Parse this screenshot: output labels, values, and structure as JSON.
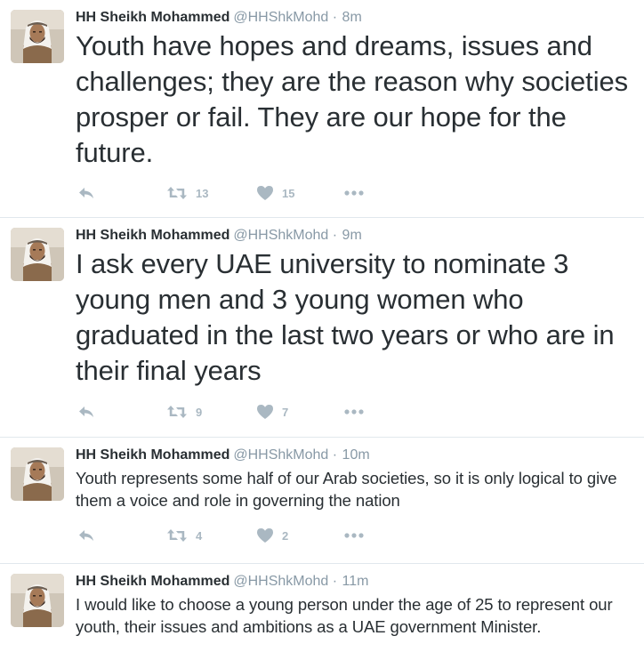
{
  "tweets": [
    {
      "author": {
        "name": "HH Sheikh Mohammed",
        "handle": "@HHShkMohd",
        "avatar_icon": "profile-photo"
      },
      "separator": "·",
      "time": "8m",
      "text": "Youth have hopes and dreams, issues and challenges; they are the reason why societies prosper or fail. They are our hope for the future.",
      "retweets": "13",
      "likes": "15"
    },
    {
      "author": {
        "name": "HH Sheikh Mohammed",
        "handle": "@HHShkMohd",
        "avatar_icon": "profile-photo"
      },
      "separator": "·",
      "time": "9m",
      "text": "I ask every UAE university to nominate 3 young men and 3 young women who graduated in the last two years or who are in their final years",
      "retweets": "9",
      "likes": "7"
    },
    {
      "author": {
        "name": "HH Sheikh Mohammed",
        "handle": "@HHShkMohd",
        "avatar_icon": "profile-photo"
      },
      "separator": "·",
      "time": "10m",
      "text": "Youth represents some half of our Arab societies, so it is only logical to give them a voice and role in governing the nation",
      "retweets": "4",
      "likes": "2"
    },
    {
      "author": {
        "name": "HH Sheikh Mohammed",
        "handle": "@HHShkMohd",
        "avatar_icon": "profile-photo"
      },
      "separator": "·",
      "time": "11m",
      "text": "I would like to choose a young person under the age of 25 to represent our youth, their issues and ambitions as a UAE government Minister."
    }
  ],
  "icons": {
    "reply": "reply-icon",
    "retweet": "retweet-icon",
    "like": "heart-icon",
    "more": "more-icon"
  },
  "colors": {
    "text": "#292f33",
    "secondary": "#8899a6",
    "action": "#aab8c2",
    "divider": "#e1e8ed"
  }
}
